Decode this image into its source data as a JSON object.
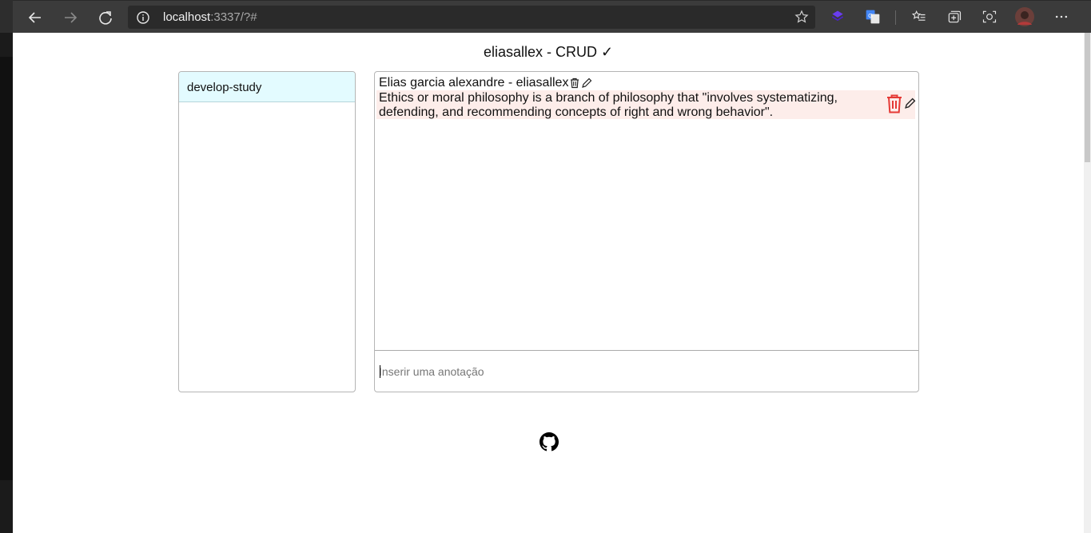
{
  "browser": {
    "url_host": "localhost",
    "url_rest": ":3337/?#",
    "icons": [
      "back-icon",
      "forward-icon",
      "refresh-icon",
      "info-icon",
      "star-icon",
      "extension-icon",
      "translate-icon",
      "favorites-icon",
      "collections-icon",
      "screenshot-icon",
      "profile-avatar",
      "more-icon"
    ]
  },
  "app": {
    "title": "eliasallex - CRUD ✓"
  },
  "sidebar": {
    "items": [
      {
        "label": "develop-study"
      }
    ]
  },
  "notes": {
    "header": "Elias garcia alexandre - eliasallex",
    "items": [
      {
        "text": "Ethics or moral philosophy is a branch of philosophy that \"involves systematizing, defending, and recommending concepts of right and wrong behavior\"."
      }
    ],
    "input_placeholder": "Inserir uma anotação"
  },
  "colors": {
    "selected_item_bg": "#e3fbff",
    "note_bg": "#fdedea",
    "delete_red": "#e53935"
  }
}
